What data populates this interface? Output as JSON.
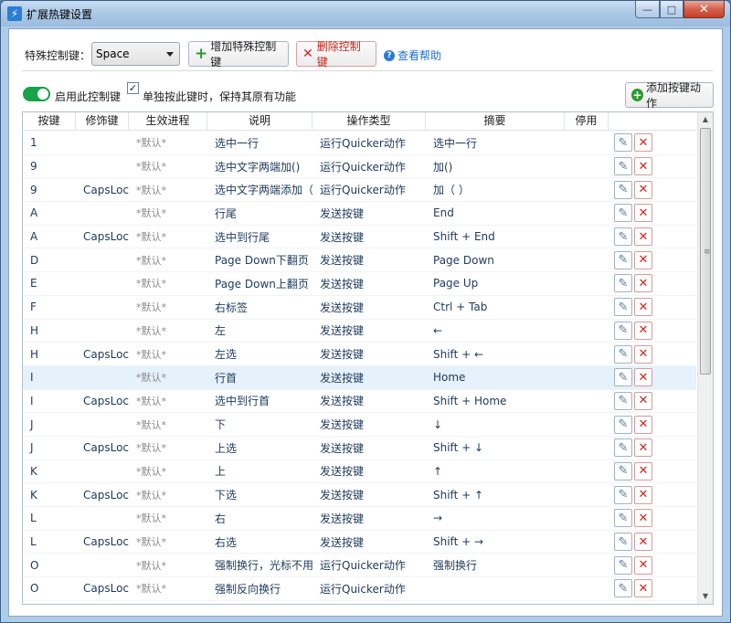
{
  "window": {
    "title": "扩展热键设置",
    "icon": "lightning-icon"
  },
  "window_controls": {
    "minimize": "—",
    "maximize": "□",
    "close": "✕"
  },
  "toolbar": {
    "special_key_label": "特殊控制键：",
    "special_key_value": "Space",
    "add_button": "增加特殊控制键",
    "delete_button": "删除控制键",
    "help_link": "查看帮助"
  },
  "options": {
    "enable_label": "启用此控制键",
    "enable_on": true,
    "keep_function_checked": true,
    "keep_function_label": "单独按此键时，保持其原有功能",
    "add_action_button": "添加按键动作"
  },
  "grid": {
    "columns": [
      "按键",
      "修饰键",
      "生效进程",
      "说明",
      "操作类型",
      "摘要",
      "停用"
    ],
    "rows": [
      {
        "key": "1",
        "mod": "",
        "proc": "*默认*",
        "desc": "选中一行",
        "type": "运行Quicker动作",
        "summary": "选中一行"
      },
      {
        "key": "9",
        "mod": "",
        "proc": "*默认*",
        "desc": "选中文字两端加()",
        "type": "运行Quicker动作",
        "summary": "加()"
      },
      {
        "key": "9",
        "mod": "CapsLoc",
        "proc": "*默认*",
        "desc": "选中文字两端添加（",
        "type": "运行Quicker动作",
        "summary": "加（ ）"
      },
      {
        "key": "A",
        "mod": "",
        "proc": "*默认*",
        "desc": "行尾",
        "type": "发送按键",
        "summary": "End"
      },
      {
        "key": "A",
        "mod": "CapsLoc",
        "proc": "*默认*",
        "desc": "选中到行尾",
        "type": "发送按键",
        "summary": "Shift + End"
      },
      {
        "key": "D",
        "mod": "",
        "proc": "*默认*",
        "desc": "Page Down下翻页",
        "type": "发送按键",
        "summary": "Page Down"
      },
      {
        "key": "E",
        "mod": "",
        "proc": "*默认*",
        "desc": "Page Down上翻页",
        "type": "发送按键",
        "summary": "Page Up"
      },
      {
        "key": "F",
        "mod": "",
        "proc": "*默认*",
        "desc": "右标签",
        "type": "发送按键",
        "summary": "Ctrl + Tab"
      },
      {
        "key": "H",
        "mod": "",
        "proc": "*默认*",
        "desc": "左",
        "type": "发送按键",
        "summary": "←"
      },
      {
        "key": "H",
        "mod": "CapsLoc",
        "proc": "*默认*",
        "desc": "左选",
        "type": "发送按键",
        "summary": "Shift + ←"
      },
      {
        "key": "I",
        "mod": "",
        "proc": "*默认*",
        "desc": "行首",
        "type": "发送按键",
        "summary": "Home"
      },
      {
        "key": "I",
        "mod": "CapsLoc",
        "proc": "*默认*",
        "desc": "选中到行首",
        "type": "发送按键",
        "summary": "Shift + Home"
      },
      {
        "key": "J",
        "mod": "",
        "proc": "*默认*",
        "desc": "下",
        "type": "发送按键",
        "summary": "↓"
      },
      {
        "key": "J",
        "mod": "CapsLoc",
        "proc": "*默认*",
        "desc": "上选",
        "type": "发送按键",
        "summary": "Shift + ↓"
      },
      {
        "key": "K",
        "mod": "",
        "proc": "*默认*",
        "desc": "上",
        "type": "发送按键",
        "summary": "↑"
      },
      {
        "key": "K",
        "mod": "CapsLoc",
        "proc": "*默认*",
        "desc": "下选",
        "type": "发送按键",
        "summary": "Shift + ↑"
      },
      {
        "key": "L",
        "mod": "",
        "proc": "*默认*",
        "desc": "右",
        "type": "发送按键",
        "summary": "→"
      },
      {
        "key": "L",
        "mod": "CapsLoc",
        "proc": "*默认*",
        "desc": "右选",
        "type": "发送按键",
        "summary": "Shift + →"
      },
      {
        "key": "O",
        "mod": "",
        "proc": "*默认*",
        "desc": "强制换行，光标不用",
        "type": "运行Quicker动作",
        "summary": "强制换行"
      },
      {
        "key": "O",
        "mod": "CapsLoc",
        "proc": "*默认*",
        "desc": "强制反向换行",
        "type": "运行Quicker动作",
        "summary": ""
      }
    ],
    "selected_row": 10
  },
  "icons": {
    "edit": "pencil-icon",
    "delete": "red-x-icon",
    "add": "green-plus-icon",
    "help": "question-circle-icon"
  },
  "colors": {
    "accent": "#1d6fd0",
    "toggle_on": "#16a34a",
    "delete_red": "#d8261b",
    "selected_row": "#e5f1fb"
  }
}
